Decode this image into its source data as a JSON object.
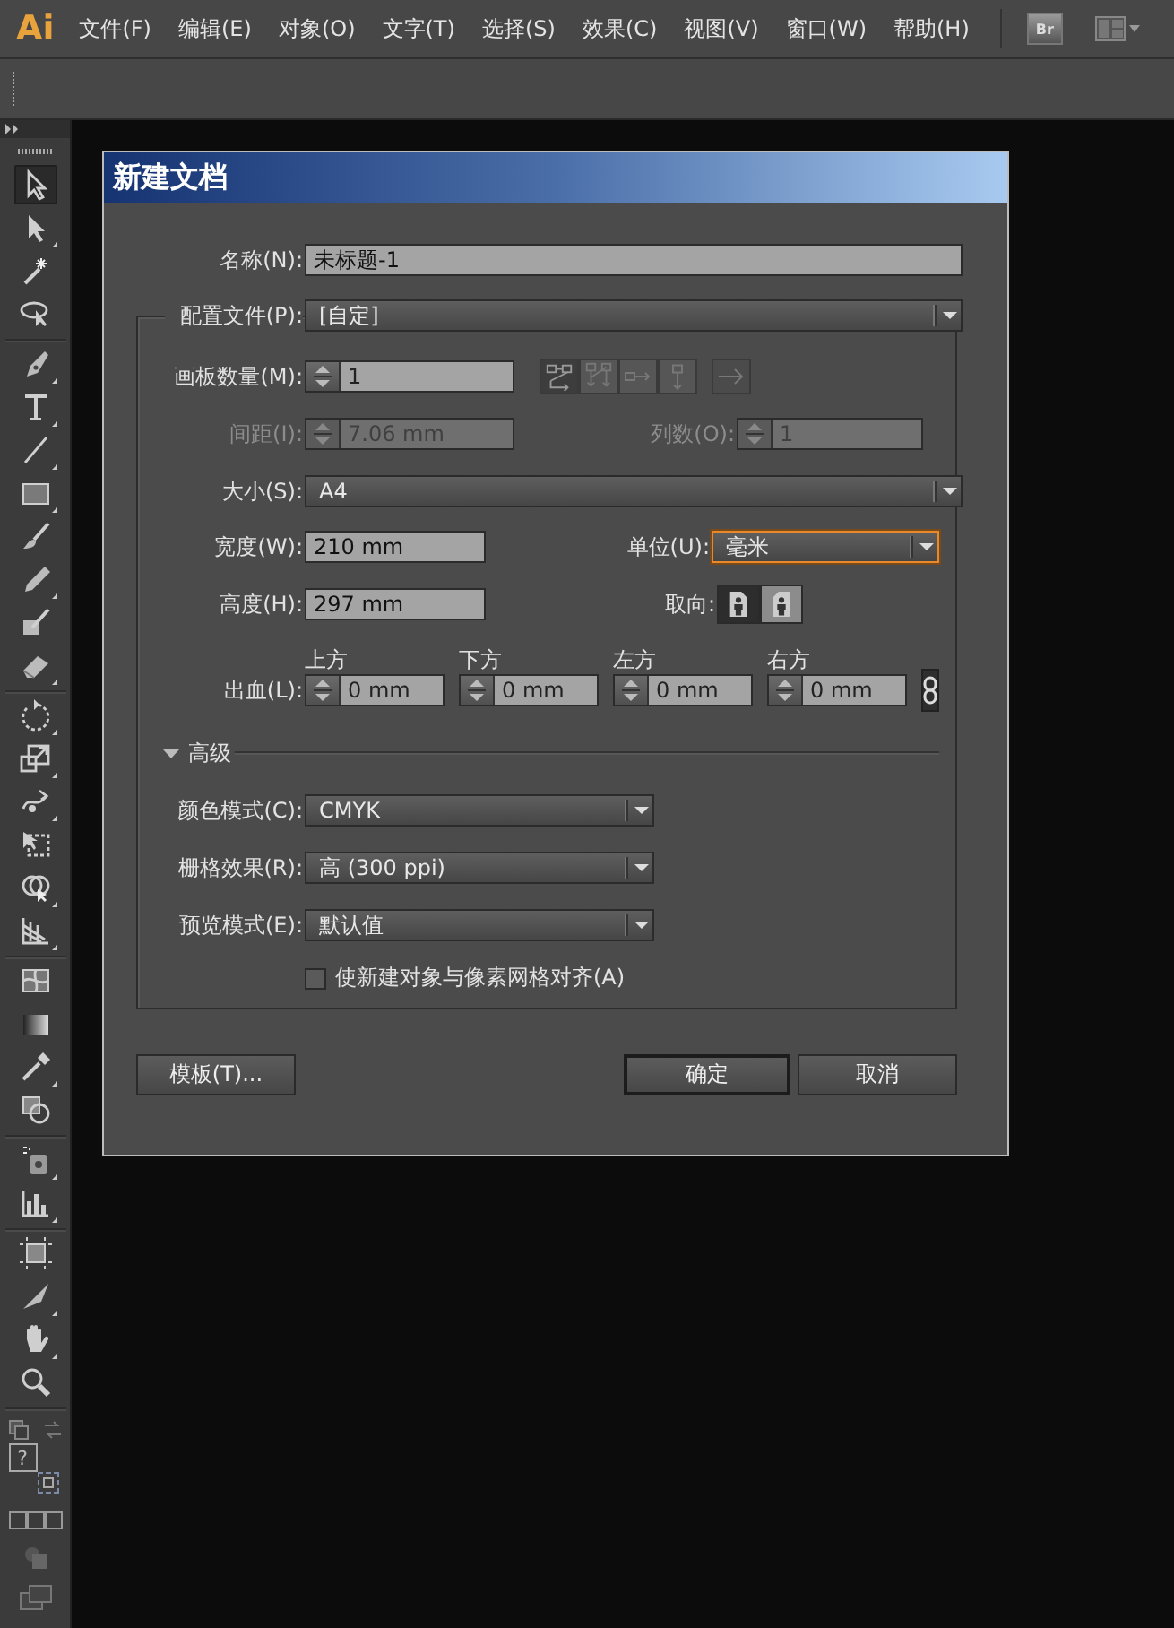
{
  "menubar": {
    "logo": "Ai",
    "menus": [
      "文件(F)",
      "编辑(E)",
      "对象(O)",
      "文字(T)",
      "选择(S)",
      "效果(C)",
      "视图(V)",
      "窗口(W)",
      "帮助(H)"
    ],
    "bridge_label": "Br"
  },
  "toolbox": {
    "tool_groups": [
      {
        "tools": [
          {
            "kind": "selection",
            "selected": true,
            "flyout": false
          },
          {
            "kind": "direct-selection",
            "selected": false,
            "flyout": true
          },
          {
            "kind": "magic-wand",
            "selected": false,
            "flyout": false
          },
          {
            "kind": "lasso",
            "selected": false,
            "flyout": false
          }
        ]
      },
      {
        "tools": [
          {
            "kind": "pen",
            "selected": false,
            "flyout": true
          },
          {
            "kind": "type",
            "selected": false,
            "flyout": true
          },
          {
            "kind": "line",
            "selected": false,
            "flyout": true
          },
          {
            "kind": "rectangle",
            "selected": false,
            "flyout": true
          },
          {
            "kind": "paintbrush",
            "selected": false,
            "flyout": false
          },
          {
            "kind": "pencil",
            "selected": false,
            "flyout": true
          },
          {
            "kind": "blob-brush",
            "selected": false,
            "flyout": false
          },
          {
            "kind": "eraser",
            "selected": false,
            "flyout": true
          }
        ]
      },
      {
        "tools": [
          {
            "kind": "rotate",
            "selected": false,
            "flyout": true
          },
          {
            "kind": "scale",
            "selected": false,
            "flyout": true
          },
          {
            "kind": "warp",
            "selected": false,
            "flyout": true
          },
          {
            "kind": "free-transform",
            "selected": false,
            "flyout": false
          },
          {
            "kind": "shape-builder",
            "selected": false,
            "flyout": true
          },
          {
            "kind": "perspective-grid",
            "selected": false,
            "flyout": true
          }
        ]
      },
      {
        "tools": [
          {
            "kind": "mesh",
            "selected": false,
            "flyout": false
          },
          {
            "kind": "gradient",
            "selected": false,
            "flyout": false
          },
          {
            "kind": "eyedropper",
            "selected": false,
            "flyout": true
          },
          {
            "kind": "blend",
            "selected": false,
            "flyout": false
          }
        ]
      },
      {
        "tools": [
          {
            "kind": "symbol-sprayer",
            "selected": false,
            "flyout": true
          },
          {
            "kind": "column-graph",
            "selected": false,
            "flyout": true
          }
        ]
      },
      {
        "tools": [
          {
            "kind": "artboard",
            "selected": false,
            "flyout": false
          },
          {
            "kind": "slice",
            "selected": false,
            "flyout": true
          },
          {
            "kind": "hand",
            "selected": false,
            "flyout": true
          },
          {
            "kind": "zoom",
            "selected": false,
            "flyout": false
          }
        ]
      }
    ],
    "fill_label": "?"
  },
  "dialog": {
    "title": "新建文档",
    "name": {
      "label": "名称(N):",
      "value": "未标题-1"
    },
    "profile": {
      "label": "配置文件(P):",
      "value": "[自定]"
    },
    "artboards": {
      "label": "画板数量(M):",
      "value": "1",
      "arrangements": [
        {
          "kind": "grid-by-row",
          "selected": true
        },
        {
          "kind": "grid-by-column",
          "selected": false
        },
        {
          "kind": "row",
          "selected": false
        },
        {
          "kind": "column",
          "selected": false
        }
      ]
    },
    "spacing": {
      "label": "间距(I):",
      "value": "7.06 mm",
      "disabled": true
    },
    "columns": {
      "label": "列数(O):",
      "value": "1",
      "disabled": true
    },
    "size": {
      "label": "大小(S):",
      "value": "A4"
    },
    "width": {
      "label": "宽度(W):",
      "value": "210 mm"
    },
    "units": {
      "label": "单位(U):",
      "value": "毫米",
      "focused": true
    },
    "height": {
      "label": "高度(H):",
      "value": "297 mm"
    },
    "orientation": {
      "label": "取向:",
      "options": [
        {
          "kind": "portrait",
          "selected": true
        },
        {
          "kind": "landscape",
          "selected": false
        }
      ]
    },
    "bleed": {
      "label": "出血(L):",
      "linked": true,
      "fields": [
        {
          "label": "上方",
          "value": "0 mm"
        },
        {
          "label": "下方",
          "value": "0 mm"
        },
        {
          "label": "左方",
          "value": "0 mm"
        },
        {
          "label": "右方",
          "value": "0 mm"
        }
      ]
    },
    "advanced": {
      "label": "高级",
      "expanded": true
    },
    "color_mode": {
      "label": "颜色模式(C):",
      "value": "CMYK"
    },
    "raster_effects": {
      "label": "栅格效果(R):",
      "value": "高 (300 ppi)"
    },
    "preview_mode": {
      "label": "预览模式(E):",
      "value": "默认值"
    },
    "align_pixel": {
      "label": "使新建对象与像素网格对齐(A)",
      "checked": false
    },
    "buttons": [
      {
        "label": "模板(T)...",
        "default": false
      },
      {
        "label": "确定",
        "default": true
      },
      {
        "label": "取消",
        "default": false
      }
    ]
  }
}
